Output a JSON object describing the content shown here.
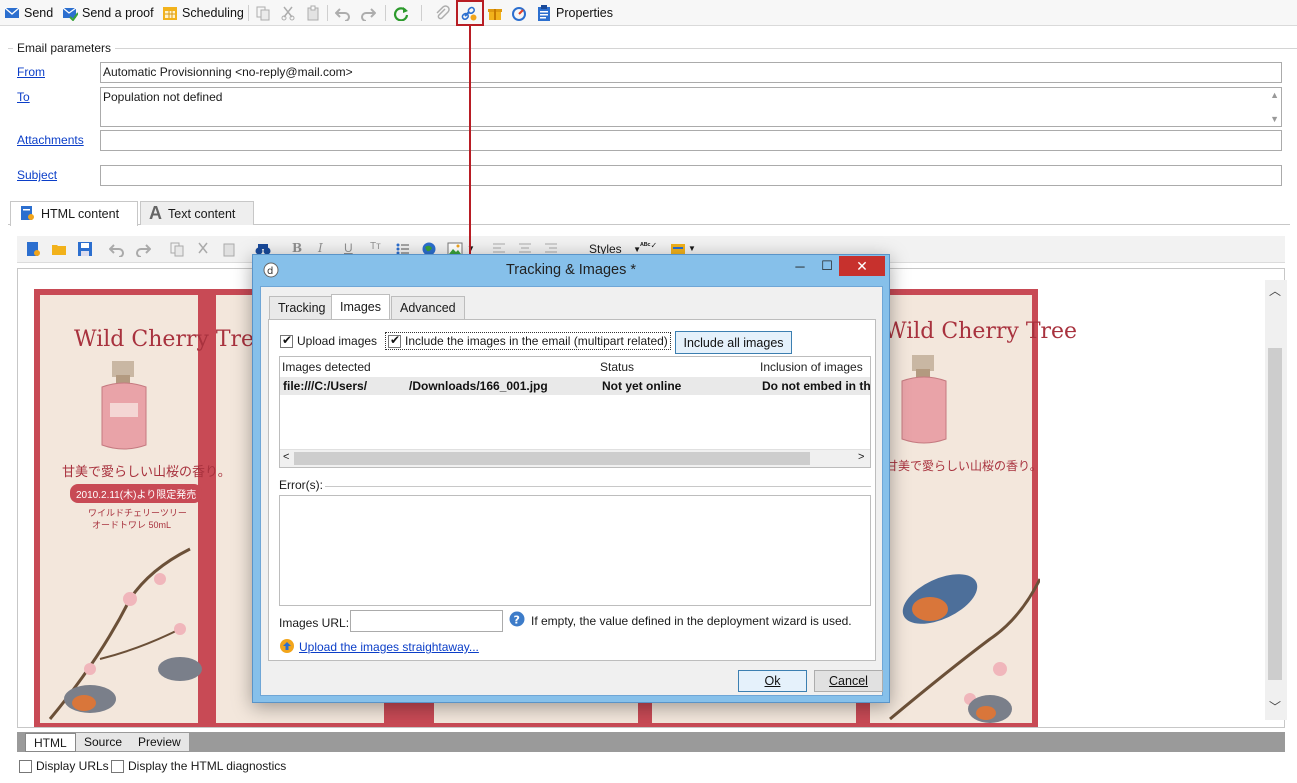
{
  "toolbar": {
    "send": "Send",
    "send_proof": "Send a proof",
    "scheduling": "Scheduling",
    "properties": "Properties"
  },
  "params": {
    "legend": "Email parameters",
    "from_label": "From",
    "from_value": "Automatic Provisionning <no-reply@mail.com>",
    "to_label": "To",
    "to_value": "Population not defined",
    "attachments_label": "Attachments",
    "attachments_value": "",
    "subject_label": "Subject",
    "subject_value": ""
  },
  "content_tabs": {
    "html": "HTML content",
    "text": "Text content"
  },
  "editor": {
    "styles_label": "Styles",
    "image_titles": [
      "Wild Cherry Tree",
      "Wild Cherry Tree"
    ],
    "tagline": "甘美で愛らしい山桜の香り。",
    "date_banner": "2010.2.11(木)より限定発売",
    "product_line1": "ワイルドチェリーツリー",
    "product_line2": "オードトワレ",
    "volume": "50mL"
  },
  "bottom_tabs": [
    "HTML",
    "Source",
    "Preview"
  ],
  "bottom_checks": {
    "display_urls": "Display URLs",
    "display_diag": "Display the HTML diagnostics"
  },
  "dialog": {
    "title": "Tracking & Images *",
    "tabs": [
      "Tracking",
      "Images",
      "Advanced"
    ],
    "active_tab": "Images",
    "upload_images_label": "Upload images",
    "upload_images_checked": true,
    "include_images_label": "Include the images in the email (multipart related)",
    "include_images_checked": true,
    "include_all_button": "Include all images",
    "columns": [
      "Images detected",
      "Status",
      "Inclusion of images"
    ],
    "rows": [
      {
        "path_a": "file:///C:/Users/",
        "path_b": "/Downloads/166_001.jpg",
        "status": "Not yet online",
        "inclusion": "Do not embed in th"
      }
    ],
    "errors_label": "Error(s):",
    "images_url_label": "Images URL:",
    "images_url_value": "",
    "images_url_hint": "If empty, the value defined in the deployment wizard is used.",
    "upload_link": "Upload the images straightaway...",
    "ok_button": "Ok",
    "cancel_button": "Cancel"
  },
  "colors": {
    "accent_red": "#b81d24",
    "dialog_frame": "#86c0ea",
    "link": "#0b3ec8"
  }
}
